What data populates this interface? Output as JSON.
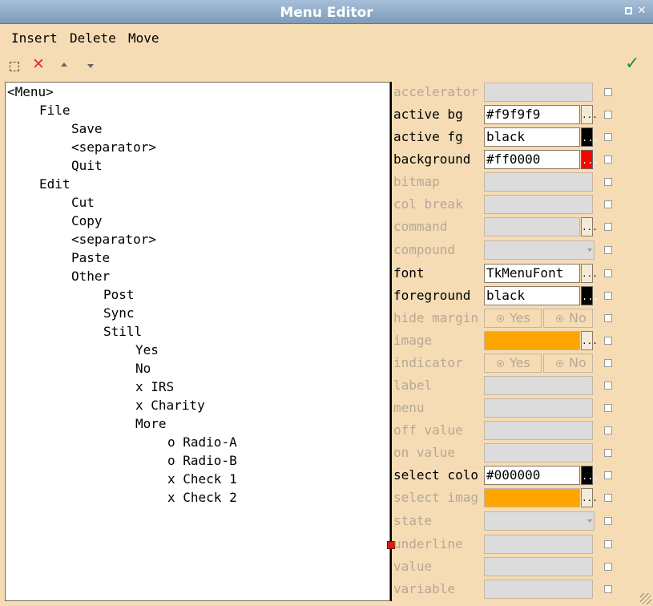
{
  "window": {
    "title": "Menu Editor"
  },
  "menubar": [
    "Insert",
    "Delete",
    "Move"
  ],
  "toolbar": {
    "icons": [
      "new-item-icon",
      "delete-icon",
      "move-up-icon",
      "move-down-icon",
      "apply-checkmark-icon"
    ],
    "delete_glyph": "✕",
    "apply_glyph": "✓"
  },
  "tree": [
    {
      "label": "<Menu>",
      "depth": 0
    },
    {
      "label": "File",
      "depth": 1
    },
    {
      "label": "Save",
      "depth": 2
    },
    {
      "label": "<separator>",
      "depth": 2
    },
    {
      "label": "Quit",
      "depth": 2
    },
    {
      "label": "Edit",
      "depth": 1
    },
    {
      "label": "Cut",
      "depth": 2
    },
    {
      "label": "Copy",
      "depth": 2
    },
    {
      "label": "<separator>",
      "depth": 2
    },
    {
      "label": "Paste",
      "depth": 2
    },
    {
      "label": "Other",
      "depth": 2
    },
    {
      "label": "Post",
      "depth": 3
    },
    {
      "label": "Sync",
      "depth": 3
    },
    {
      "label": "Still",
      "depth": 3
    },
    {
      "label": "Yes",
      "depth": 4
    },
    {
      "label": "No",
      "depth": 4
    },
    {
      "label": "x IRS",
      "depth": 4
    },
    {
      "label": "x Charity",
      "depth": 4
    },
    {
      "label": "More",
      "depth": 4
    },
    {
      "label": "o Radio-A",
      "depth": 5
    },
    {
      "label": "o Radio-B",
      "depth": 5
    },
    {
      "label": "x Check 1",
      "depth": 5
    },
    {
      "label": "x Check 2",
      "depth": 5
    }
  ],
  "properties": [
    {
      "label": "accelerator",
      "enabled": false,
      "kind": "text",
      "value": ""
    },
    {
      "label": "active bg",
      "enabled": true,
      "kind": "text-ellipsis",
      "value": "#f9f9f9"
    },
    {
      "label": "active fg",
      "enabled": true,
      "kind": "text-swatch",
      "value": "black",
      "swatch": "#000000"
    },
    {
      "label": "background",
      "enabled": true,
      "kind": "text-swatch",
      "value": "#ff0000",
      "swatch": "#ff0000"
    },
    {
      "label": "bitmap",
      "enabled": false,
      "kind": "text",
      "value": ""
    },
    {
      "label": "col break",
      "enabled": false,
      "kind": "text",
      "value": ""
    },
    {
      "label": "command",
      "enabled": false,
      "kind": "text-ellipsis",
      "value": ""
    },
    {
      "label": "compound",
      "enabled": false,
      "kind": "combo",
      "value": ""
    },
    {
      "label": "font",
      "enabled": true,
      "kind": "text-ellipsis",
      "value": "TkMenuFont"
    },
    {
      "label": "foreground",
      "enabled": true,
      "kind": "text-swatch",
      "value": "black",
      "swatch": "#000000"
    },
    {
      "label": "hide margin",
      "enabled": false,
      "kind": "radio",
      "yes": "Yes",
      "no": "No"
    },
    {
      "label": "image",
      "enabled": false,
      "kind": "image",
      "value": "",
      "swatch": "#ffa500"
    },
    {
      "label": "indicator",
      "enabled": false,
      "kind": "radio",
      "yes": "Yes",
      "no": "No"
    },
    {
      "label": "label",
      "enabled": false,
      "kind": "text",
      "value": ""
    },
    {
      "label": "menu",
      "enabled": false,
      "kind": "text",
      "value": ""
    },
    {
      "label": "off value",
      "enabled": false,
      "kind": "text",
      "value": ""
    },
    {
      "label": "on value",
      "enabled": false,
      "kind": "text",
      "value": ""
    },
    {
      "label": "select colo",
      "enabled": true,
      "kind": "text-swatch",
      "value": "#000000",
      "swatch": "#000000"
    },
    {
      "label": "select imag",
      "enabled": false,
      "kind": "image",
      "value": "",
      "swatch": "#ffa500"
    },
    {
      "label": "state",
      "enabled": false,
      "kind": "combo",
      "value": ""
    },
    {
      "label": "underline",
      "enabled": false,
      "kind": "text",
      "value": ""
    },
    {
      "label": "value",
      "enabled": false,
      "kind": "text",
      "value": ""
    },
    {
      "label": "variable",
      "enabled": false,
      "kind": "text",
      "value": ""
    }
  ],
  "ellipsis_label": "...",
  "colors": {
    "window_bg": "#f5dcb4",
    "titlebar": "#8fa9c7",
    "disabled_text": "#b7a896",
    "accent_green": "#1f9a1f"
  }
}
